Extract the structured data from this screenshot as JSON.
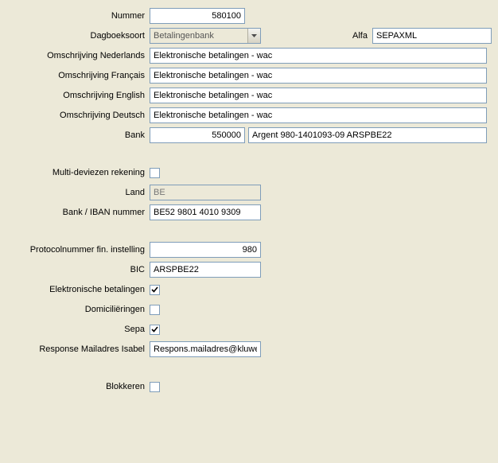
{
  "labels": {
    "nummer": "Nummer",
    "dagboeksoort": "Dagboeksoort",
    "alfa": "Alfa",
    "omsch_nl": "Omschrijving Nederlands",
    "omsch_fr": "Omschrijving Français",
    "omsch_en": "Omschrijving English",
    "omsch_de": "Omschrijving Deutsch",
    "bank": "Bank",
    "multi": "Multi-deviezen rekening",
    "land": "Land",
    "iban": "Bank / IBAN nummer",
    "protocol": "Protocolnummer fin. instelling",
    "bic": "BIC",
    "elekbet": "Elektronische betalingen",
    "domic": "Domiciliëringen",
    "sepa": "Sepa",
    "response": "Response Mailadres Isabel",
    "blokkeren": "Blokkeren"
  },
  "values": {
    "nummer": "580100",
    "dagboeksoort": "Betalingenbank",
    "alfa": "SEPAXML",
    "omsch_nl": "Elektronische betalingen - wac",
    "omsch_fr": "Elektronische betalingen - wac",
    "omsch_en": "Elektronische betalingen - wac",
    "omsch_de": "Elektronische betalingen - wac",
    "bank_code": "550000",
    "bank_desc": "Argent 980-1401093-09 ARSPBE22",
    "land": "BE",
    "iban": "BE52 9801 4010 9309",
    "protocol": "980",
    "bic": "ARSPBE22",
    "response": "Respons.mailadres@kluwer."
  },
  "checks": {
    "multi": false,
    "elekbet": true,
    "domic": false,
    "sepa": true,
    "blokkeren": false
  }
}
